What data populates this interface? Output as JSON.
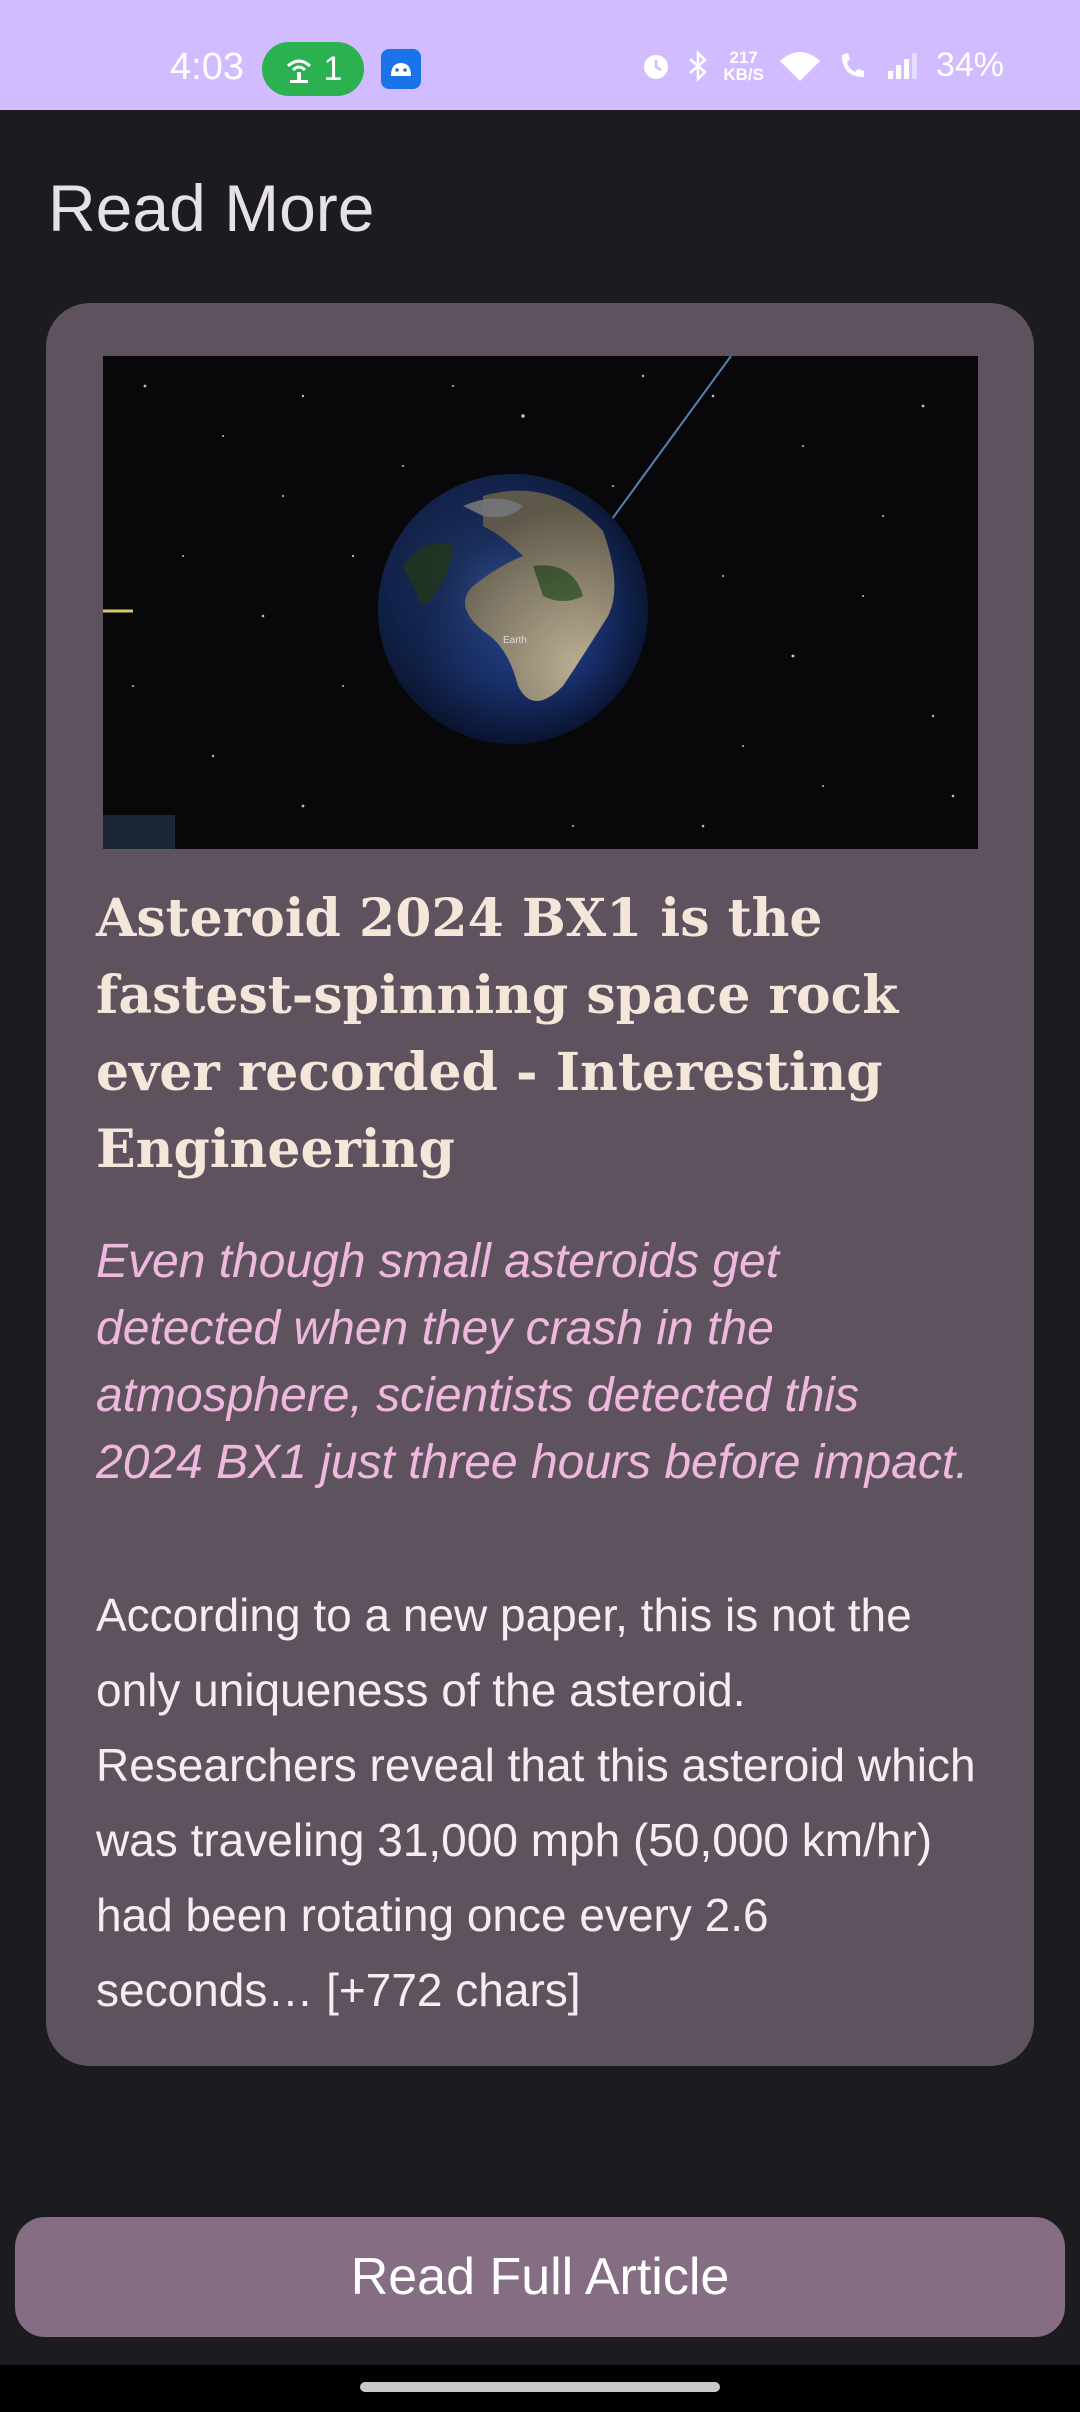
{
  "status_bar": {
    "time": "4:03",
    "hotspot_count": "1",
    "network_speed_value": "217",
    "network_speed_unit": "KB/S",
    "battery": "34%",
    "icons": [
      "hotspot-icon",
      "android-icon",
      "alarm-icon",
      "bluetooth-icon",
      "wifi-icon",
      "wifi-calling-icon",
      "signal-icon"
    ]
  },
  "header": {
    "title": "Read More"
  },
  "article": {
    "image_label": "Earth",
    "title": "Asteroid 2024 BX1 is the fastest-spinning space rock ever recorded - Interesting Engineering",
    "summary": "Even though small asteroids get detected when they crash in the atmosphere, scientists detected this 2024 BX1 just three hours before impact.",
    "body": "According to a new paper, this is not the only uniqueness of the asteroid. Researchers reveal that this asteroid which was traveling 31,000 mph (50,000 km/hr) had been rotating once every 2.6 seconds… [+772 chars]"
  },
  "actions": {
    "read_full_label": "Read Full Article"
  },
  "colors": {
    "status_bar_bg": "#d0bcff",
    "page_bg": "#1c1b1f",
    "card_bg": "#5e525f",
    "title_color": "#f5e6da",
    "summary_color": "#efb8de",
    "button_bg": "#856e84"
  }
}
